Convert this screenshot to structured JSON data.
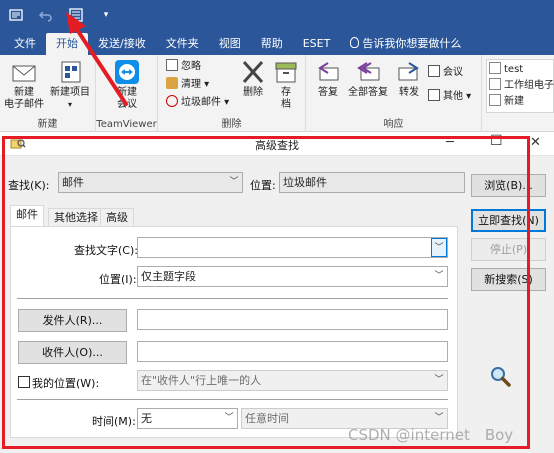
{
  "quick_access": {
    "icons": [
      "send-receive-icon",
      "undo-icon",
      "advanced-find-icon",
      "customize-icon"
    ]
  },
  "ribbon": {
    "tabs": [
      "文件",
      "开始",
      "发送/接收",
      "文件夹",
      "视图",
      "帮助",
      "ESET"
    ],
    "tell_me": "告诉我你想要做什么",
    "groups": {
      "new": {
        "name": "新建",
        "new_email": "新建\n电子邮件",
        "new_items": "新建项目"
      },
      "teamviewer": {
        "name": "TeamViewer",
        "new_meeting": "新建\n会议"
      },
      "delete": {
        "name": "删除",
        "ignore": "忽略",
        "cleanup": "清理",
        "junk": "垃圾邮件",
        "delete": "删除",
        "archive": "存\n档"
      },
      "respond": {
        "name": "响应",
        "reply": "答复",
        "reply_all": "全部答复",
        "forward": "转发",
        "meeting": "会议",
        "more": "其他"
      },
      "quick_steps": {
        "items": [
          "test",
          "工作组电子",
          "新建"
        ]
      }
    }
  },
  "dialog": {
    "title": "高级查找",
    "find_label": "查找(K):",
    "find_value": "邮件",
    "location_label": "位置:",
    "location_value": "垃圾邮件",
    "browse_button": "浏览(B)...",
    "find_now_button": "立即查找(N)",
    "stop_button": "停止(P)",
    "new_search_button": "新搜索(S)",
    "tabs": [
      "邮件",
      "其他选择",
      "高级"
    ],
    "search_text_label": "查找文字(C):",
    "search_text_value": "",
    "in_label": "位置(I):",
    "in_value": "仅主题字段",
    "from_button": "发件人(R)...",
    "sent_to_button": "收件人(O)...",
    "where_i_am_label": "我的位置(W):",
    "where_i_am_value": "在\"收件人\"行上唯一的人",
    "time_label": "时间(M):",
    "time_value": "无",
    "time_range_value": "任意时间"
  },
  "watermark": "CSDN @internet　Boy",
  "colors": {
    "ribbon_blue": "#2b579a",
    "annotation_red": "#e51c23",
    "focus_blue": "#0078d7"
  }
}
